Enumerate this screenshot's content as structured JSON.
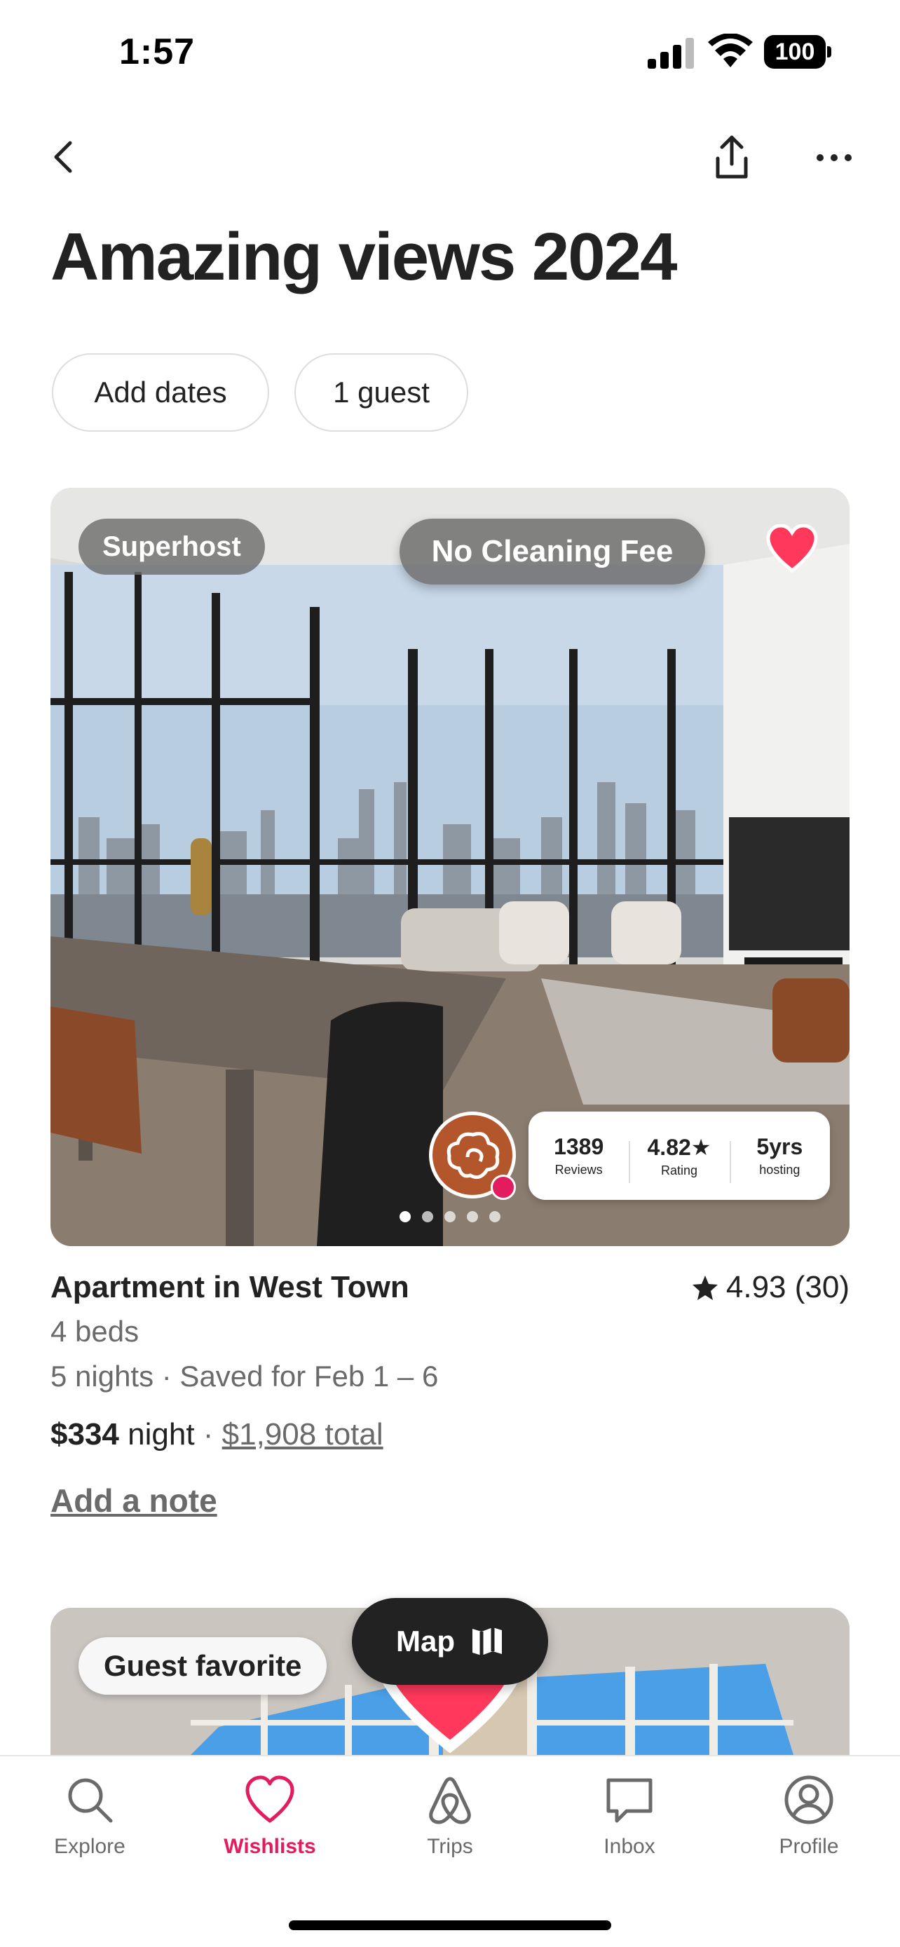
{
  "status_bar": {
    "time": "1:57",
    "battery": "100"
  },
  "nav": {
    "back_icon": "chevron-left-icon",
    "share_icon": "share-icon",
    "more_icon": "more-dots-icon"
  },
  "page": {
    "title": "Amazing views 2024"
  },
  "filters": {
    "dates": "Add dates",
    "guests": "1 guest"
  },
  "listing": {
    "badge_superhost": "Superhost",
    "badge_promo": "No Cleaning Fee",
    "favorited": true,
    "stats": [
      {
        "value": "1389",
        "label": "Reviews"
      },
      {
        "value": "4.82★",
        "label": "Rating"
      },
      {
        "value": "5yrs",
        "label": "hosting"
      }
    ],
    "photo_count": 5,
    "active_photo": 1,
    "title": "Apartment in West Town",
    "rating": "4.93 (30)",
    "beds": "4 beds",
    "dates": "5 nights · Saved for Feb 1 – 6",
    "price": "$334",
    "price_unit": "night",
    "price_separator": "·",
    "total": "$1,908 total",
    "add_note": "Add a note"
  },
  "listing_2": {
    "badge": "Guest favorite",
    "favorited": true
  },
  "map_button": {
    "label": "Map",
    "icon": "map-icon"
  },
  "tabs": [
    {
      "label": "Explore",
      "icon": "search-icon",
      "active": false
    },
    {
      "label": "Wishlists",
      "icon": "heart-icon",
      "active": true
    },
    {
      "label": "Trips",
      "icon": "airbnb-logo-icon",
      "active": false
    },
    {
      "label": "Inbox",
      "icon": "message-icon",
      "active": false
    },
    {
      "label": "Profile",
      "icon": "profile-icon",
      "active": false
    }
  ],
  "colors": {
    "accent": "#E31C5F",
    "text": "#222222",
    "secondary_text": "#6A6A6A",
    "map_button": "#222222"
  }
}
